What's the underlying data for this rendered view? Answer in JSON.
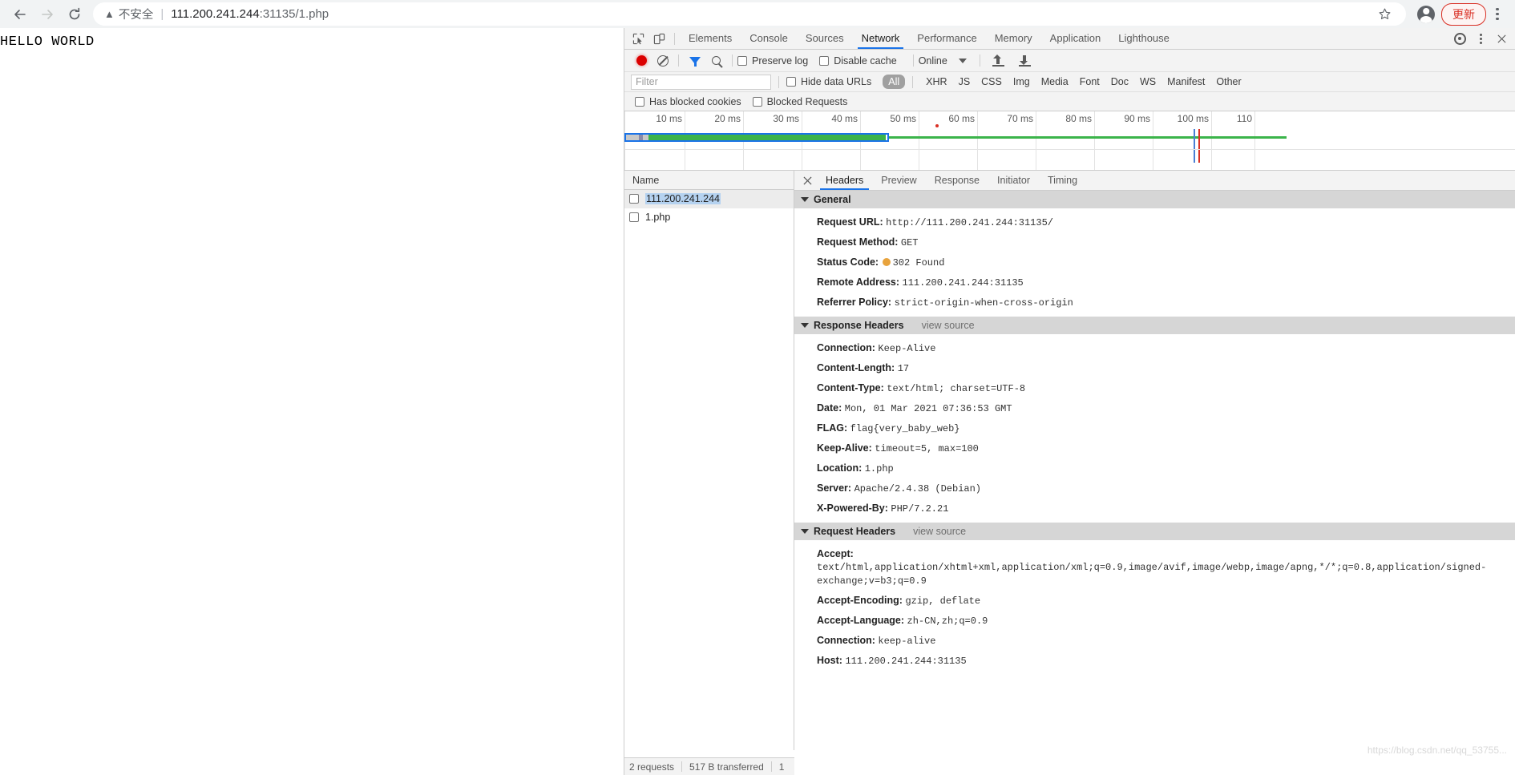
{
  "browser": {
    "back_icon": "back-arrow-icon",
    "forward_icon": "forward-arrow-icon",
    "reload_icon": "reload-icon",
    "security_label": "不安全",
    "url_host": "111.200.241.244",
    "url_rest": ":31135/1.php",
    "star_icon": "☆",
    "update_button": "更新"
  },
  "page": {
    "body_text": "HELLO WORLD"
  },
  "devtools": {
    "tabs": [
      {
        "label": "Elements",
        "active": false
      },
      {
        "label": "Console",
        "active": false
      },
      {
        "label": "Sources",
        "active": false
      },
      {
        "label": "Network",
        "active": true
      },
      {
        "label": "Performance",
        "active": false
      },
      {
        "label": "Memory",
        "active": false
      },
      {
        "label": "Application",
        "active": false
      },
      {
        "label": "Lighthouse",
        "active": false
      }
    ],
    "toolbar": {
      "record_icon": "record-icon",
      "clear_icon": "clear-icon",
      "filter_icon": "filter-funnel-icon",
      "search_icon": "search-icon",
      "preserve_log": "Preserve log",
      "disable_cache": "Disable cache",
      "throttle_value": "Online",
      "import_icon": "import-har-icon",
      "export_icon": "export-har-icon"
    },
    "filters": {
      "placeholder": "Filter",
      "value": "",
      "hide_data_urls": "Hide data URLs",
      "resource_types": [
        "All",
        "XHR",
        "JS",
        "CSS",
        "Img",
        "Media",
        "Font",
        "Doc",
        "WS",
        "Manifest",
        "Other"
      ],
      "selected_type": "All",
      "has_blocked_cookies": "Has blocked cookies",
      "blocked_requests": "Blocked Requests"
    },
    "overview": {
      "ticks": [
        "10 ms",
        "20 ms",
        "30 ms",
        "40 ms",
        "50 ms",
        "60 ms",
        "70 ms",
        "80 ms",
        "90 ms",
        "100 ms",
        "110"
      ]
    },
    "requests": {
      "column_header": "Name",
      "rows": [
        {
          "name": "111.200.241.244",
          "selected": true
        },
        {
          "name": "1.php",
          "selected": false
        }
      ]
    },
    "status_bar": {
      "requests": "2 requests",
      "transferred": "517 B transferred",
      "extra": "1"
    },
    "detail_tabs": [
      {
        "label": "Headers",
        "active": true
      },
      {
        "label": "Preview",
        "active": false
      },
      {
        "label": "Response",
        "active": false
      },
      {
        "label": "Initiator",
        "active": false
      },
      {
        "label": "Timing",
        "active": false
      }
    ],
    "sections": [
      {
        "title": "General",
        "view_source": "",
        "rows": [
          {
            "key": "Request URL:",
            "value": "http://111.200.241.244:31135/",
            "status": false
          },
          {
            "key": "Request Method:",
            "value": "GET",
            "status": false
          },
          {
            "key": "Status Code:",
            "value": "302 Found",
            "status": true
          },
          {
            "key": "Remote Address:",
            "value": "111.200.241.244:31135",
            "status": false
          },
          {
            "key": "Referrer Policy:",
            "value": "strict-origin-when-cross-origin",
            "status": false
          }
        ]
      },
      {
        "title": "Response Headers",
        "view_source": "view source",
        "rows": [
          {
            "key": "Connection:",
            "value": "Keep-Alive",
            "status": false
          },
          {
            "key": "Content-Length:",
            "value": "17",
            "status": false
          },
          {
            "key": "Content-Type:",
            "value": "text/html; charset=UTF-8",
            "status": false
          },
          {
            "key": "Date:",
            "value": "Mon, 01 Mar 2021 07:36:53 GMT",
            "status": false
          },
          {
            "key": "FLAG:",
            "value": "flag{very_baby_web}",
            "status": false
          },
          {
            "key": "Keep-Alive:",
            "value": "timeout=5, max=100",
            "status": false
          },
          {
            "key": "Location:",
            "value": "1.php",
            "status": false
          },
          {
            "key": "Server:",
            "value": "Apache/2.4.38 (Debian)",
            "status": false
          },
          {
            "key": "X-Powered-By:",
            "value": "PHP/7.2.21",
            "status": false
          }
        ]
      },
      {
        "title": "Request Headers",
        "view_source": "view source",
        "rows": [
          {
            "key": "Accept:",
            "value": "text/html,application/xhtml+xml,application/xml;q=0.9,image/avif,image/webp,image/apng,*/*;q=0.8,application/signed-exchange;v=b3;q=0.9",
            "status": false
          },
          {
            "key": "Accept-Encoding:",
            "value": "gzip, deflate",
            "status": false
          },
          {
            "key": "Accept-Language:",
            "value": "zh-CN,zh;q=0.9",
            "status": false
          },
          {
            "key": "Connection:",
            "value": "keep-alive",
            "status": false
          },
          {
            "key": "Host:",
            "value": "111.200.241.244:31135",
            "status": false
          }
        ]
      }
    ],
    "settings_icon": "gear-icon",
    "more_icon": "more-vertical-icon"
  },
  "watermark": "https://blog.csdn.net/qq_53755..."
}
